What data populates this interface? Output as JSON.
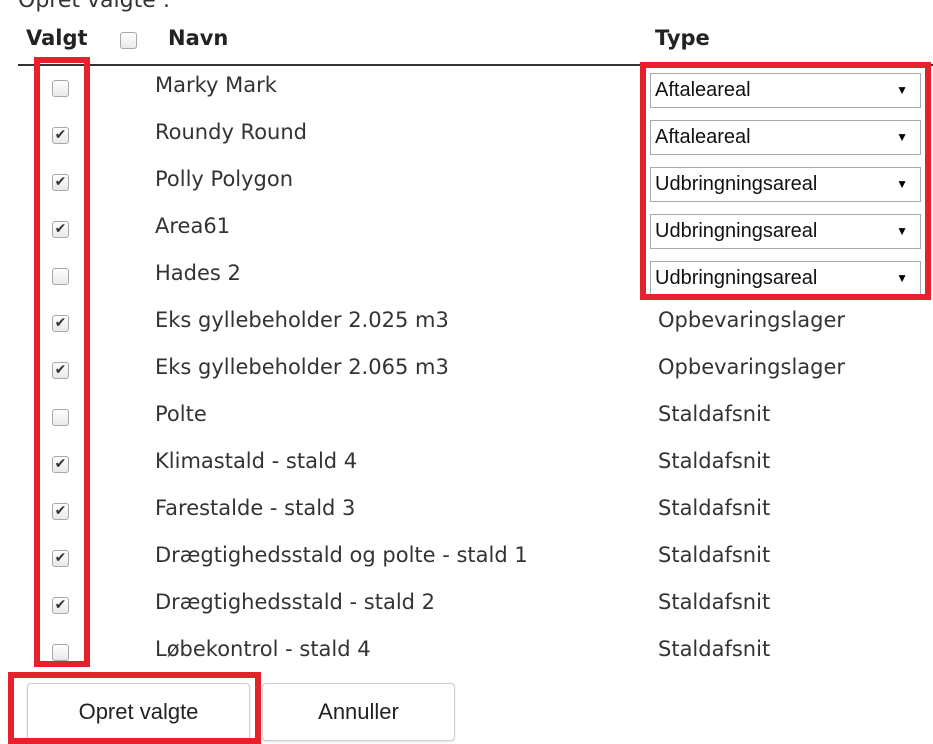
{
  "caption": "Opret valgte :",
  "header": {
    "valgt_label": "Valgt",
    "navn_label": "Navn",
    "type_label": "Type",
    "select_all_checked": false
  },
  "rows": [
    {
      "checked": false,
      "name": "Marky Mark",
      "type": "Aftaleareal",
      "type_is_dropdown": true
    },
    {
      "checked": true,
      "name": "Roundy Round",
      "type": "Aftaleareal",
      "type_is_dropdown": true
    },
    {
      "checked": true,
      "name": "Polly Polygon",
      "type": "Udbringningsareal",
      "type_is_dropdown": true
    },
    {
      "checked": true,
      "name": "Area61",
      "type": "Udbringningsareal",
      "type_is_dropdown": true
    },
    {
      "checked": false,
      "name": "Hades 2",
      "type": "Udbringningsareal",
      "type_is_dropdown": true
    },
    {
      "checked": true,
      "name": "Eks gyllebeholder 2.025 m3",
      "type": "Opbevaringslager",
      "type_is_dropdown": false
    },
    {
      "checked": true,
      "name": "Eks gyllebeholder 2.065 m3",
      "type": "Opbevaringslager",
      "type_is_dropdown": false
    },
    {
      "checked": false,
      "name": "Polte",
      "type": "Staldafsnit",
      "type_is_dropdown": false
    },
    {
      "checked": true,
      "name": "Klimastald - stald 4",
      "type": "Staldafsnit",
      "type_is_dropdown": false
    },
    {
      "checked": true,
      "name": "Farestalde - stald 3",
      "type": "Staldafsnit",
      "type_is_dropdown": false
    },
    {
      "checked": true,
      "name": "Drægtighedsstald og polte - stald 1",
      "type": "Staldafsnit",
      "type_is_dropdown": false
    },
    {
      "checked": true,
      "name": "Drægtighedsstald - stald 2",
      "type": "Staldafsnit",
      "type_is_dropdown": false
    },
    {
      "checked": false,
      "name": "Løbekontrol - stald 4",
      "type": "Staldafsnit",
      "type_is_dropdown": false
    }
  ],
  "icons": {
    "check_glyph": "✔",
    "dropdown_arrow": "▼"
  },
  "buttons": {
    "create_label": "Opret valgte",
    "cancel_label": "Annuller"
  },
  "colors": {
    "highlight": "#e5212b",
    "text": "#333333"
  }
}
